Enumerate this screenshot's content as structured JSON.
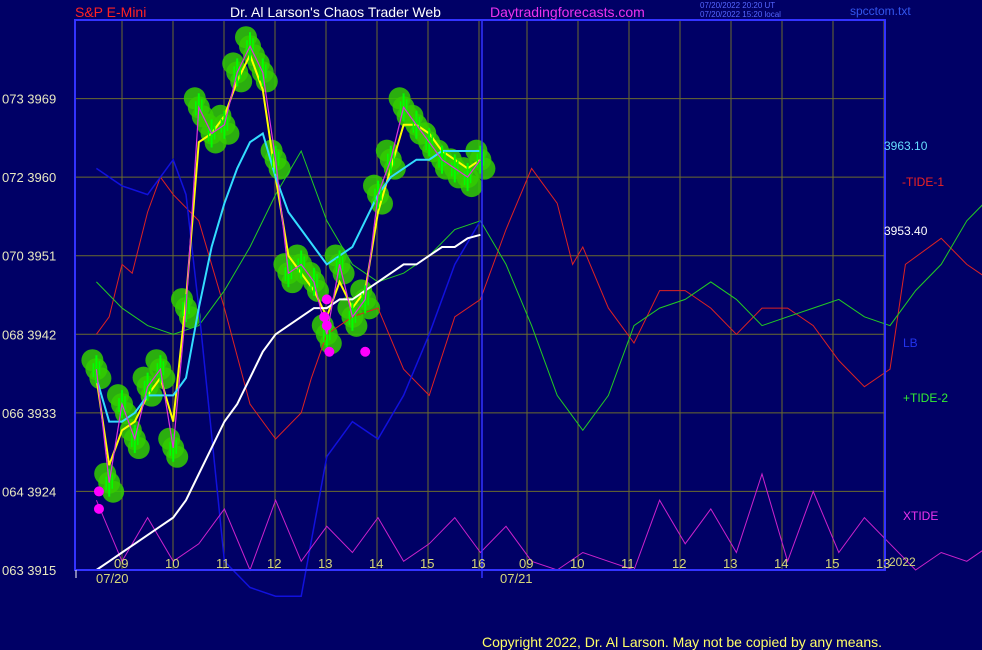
{
  "header": {
    "left_title": "S&P E-Mini",
    "center_title": "Dr. Al Larson's Chaos Trader Web",
    "site": "Daytradingforecasts.com",
    "timestamp_1": "07/20/2022 20:20 UT",
    "timestamp_2": "07/20/2022 15:20 local",
    "file_name": "spcctom.txt"
  },
  "footer": {
    "copyright": "Copyright 2022, Dr. Al Larson. May not be copied by any means."
  },
  "right_labels": {
    "price_1": "3963.10",
    "price_2": "3953.40",
    "tide1": "-TIDE-1",
    "lb": "LB",
    "tide2": "+TIDE-2",
    "xtide": "XTIDE",
    "year": "2022"
  },
  "colors": {
    "background": "#000066",
    "frame": "#3333ff",
    "grid": "#6b6b2e",
    "price_bars": "#00ff00",
    "fast_avg": "#ffff00",
    "medium_avg": "#33ddff",
    "slow_avg": "#ffffff",
    "tide1": "#dd2222",
    "tide2": "#22cc22",
    "lb": "#1111dd",
    "xtide": "#cc22cc",
    "turn_points": "#ff00ff",
    "halo": "#33cc00"
  },
  "chart_data": {
    "type": "line",
    "title": "S&P E-Mini",
    "ylim": [
      3915,
      3978
    ],
    "y_ticks": [
      {
        "code": "063",
        "price": "3915"
      },
      {
        "code": "064",
        "price": "3924"
      },
      {
        "code": "066",
        "price": "3933"
      },
      {
        "code": "068",
        "price": "3942"
      },
      {
        "code": "070",
        "price": "3951"
      },
      {
        "code": "072",
        "price": "3960"
      },
      {
        "code": "073",
        "price": "3969"
      }
    ],
    "x_ticks_hours": [
      "09",
      "10",
      "11",
      "12",
      "13",
      "14",
      "15",
      "16",
      "09",
      "10",
      "11",
      "12",
      "13",
      "14",
      "15",
      "13"
    ],
    "x_date_labels": [
      "07/20",
      "07/21"
    ],
    "x_hours": [
      8.5,
      8.75,
      9.0,
      9.25,
      9.5,
      9.75,
      10.0,
      10.25,
      10.5,
      10.75,
      11.0,
      11.25,
      11.5,
      11.75,
      12.0,
      12.25,
      12.5,
      12.75,
      13.0,
      13.25,
      13.5,
      13.75,
      14.0,
      14.25,
      14.5,
      14.75,
      15.0,
      15.25,
      15.5,
      15.75,
      16.0
    ],
    "series": [
      {
        "name": "price",
        "values": [
          3938,
          3925,
          3934,
          3930,
          3936,
          3938,
          3929,
          3945,
          3968,
          3965,
          3966,
          3972,
          3975,
          3972,
          3962,
          3949,
          3950,
          3948,
          3942,
          3950,
          3944,
          3946,
          3958,
          3962,
          3968,
          3966,
          3964,
          3962,
          3961,
          3960,
          3962
        ]
      },
      {
        "name": "fast_avg",
        "values": [
          3937,
          3927,
          3931,
          3932,
          3935,
          3937,
          3932,
          3946,
          3964,
          3965,
          3967,
          3971,
          3974,
          3970,
          3960,
          3951,
          3949,
          3947,
          3944,
          3948,
          3945,
          3947,
          3956,
          3961,
          3966,
          3966,
          3965,
          3963,
          3962,
          3961,
          3962
        ]
      },
      {
        "name": "medium_avg",
        "values": [
          3937,
          3932,
          3932,
          3933,
          3935,
          3935,
          3935,
          3937,
          3945,
          3952,
          3957,
          3961,
          3964,
          3965,
          3960,
          3956,
          3954,
          3952,
          3950,
          3951,
          3952,
          3955,
          3958,
          3960,
          3961,
          3962,
          3962,
          3963,
          3963,
          3963,
          3963
        ]
      },
      {
        "name": "slow_avg",
        "values": [
          3915,
          3916,
          3917,
          3918,
          3919,
          3920,
          3921,
          3923,
          3926,
          3929,
          3932,
          3934,
          3937,
          3940,
          3942,
          3943,
          3944,
          3945,
          3945,
          3946,
          3946,
          3947,
          3948,
          3949,
          3950,
          3950,
          3951,
          3952,
          3952,
          3953,
          3953.4
        ]
      }
    ],
    "tide1_x": [
      8.5,
      8.75,
      9.0,
      9.2,
      9.5,
      9.75,
      10.0,
      10.5,
      11.0,
      11.5,
      12.0,
      12.5,
      12.7,
      13.0,
      13.5,
      14.0,
      14.5,
      15.0,
      15.5,
      16.0,
      16.5,
      17.0,
      17.5,
      17.8,
      18.0,
      18.5,
      19.0,
      19.5,
      20.0,
      20.5,
      21.0,
      21.5,
      22.0,
      22.5,
      23.0,
      23.5,
      24.0,
      24.3,
      25.0,
      25.5,
      26.0,
      26.5,
      27.0,
      27.5,
      28.0,
      28.5,
      29.0,
      29.5,
      29.9,
      30.5,
      31.0,
      31.5,
      32.0,
      32.5,
      33.0,
      33.5,
      34.0,
      34.5,
      35.0,
      35.3
    ],
    "tide1": [
      3942,
      3944,
      3950,
      3949,
      3956,
      3960,
      3958,
      3955,
      3945,
      3934,
      3930,
      3933,
      3937,
      3942,
      3944,
      3945,
      3938,
      3935,
      3944,
      3946,
      3954,
      3961,
      3957,
      3950,
      3952,
      3945,
      3941,
      3947,
      3947,
      3945,
      3942,
      3945,
      3945,
      3943,
      3939,
      3936,
      3938,
      3950,
      3953,
      3950,
      3948,
      3945,
      3942,
      3942,
      3946,
      3950,
      3953,
      3955,
      3958,
      3960,
      3962,
      3963,
      3960,
      3955,
      3950,
      3945,
      3940,
      3936,
      3934,
      3933
    ],
    "tide2_x": [
      8.5,
      9.0,
      9.5,
      10.0,
      10.5,
      11.0,
      11.5,
      12.0,
      12.5,
      13.0,
      13.5,
      14.0,
      14.5,
      15.0,
      15.5,
      16.0,
      16.5,
      17.0,
      17.5,
      18.0,
      18.5,
      19.0,
      19.5,
      20.0,
      20.5,
      21.0,
      21.5,
      22.0,
      22.5,
      23.0,
      23.5,
      24.0,
      24.5,
      25.0,
      25.5,
      26.0,
      26.5,
      27.0,
      27.5,
      28.0,
      28.5,
      29.0,
      29.5,
      30.0,
      30.5,
      31.0,
      31.5,
      32.0,
      32.5,
      33.0,
      33.5,
      34.0,
      34.5,
      35.0,
      35.3
    ],
    "tide2": [
      3948,
      3945,
      3943,
      3942,
      3943,
      3947,
      3952,
      3958,
      3963,
      3955,
      3950,
      3948,
      3949,
      3951,
      3954,
      3955,
      3950,
      3943,
      3935,
      3931,
      3935,
      3943,
      3945,
      3946,
      3948,
      3946,
      3943,
      3944,
      3945,
      3946,
      3944,
      3943,
      3947,
      3950,
      3955,
      3958,
      3962,
      3962,
      3961,
      3958,
      3955,
      3950,
      3946,
      3945,
      3948,
      3955,
      3958,
      3957,
      3953,
      3950,
      3945,
      3941,
      3937,
      3935,
      3934
    ],
    "lb_x": [
      8.5,
      9.0,
      9.5,
      10.0,
      10.25,
      10.5,
      11.0,
      11.5,
      12.0,
      12.5,
      13.0,
      13.5,
      14.0,
      14.5,
      15.0,
      15.5,
      16.0
    ],
    "lb": [
      3961,
      3959,
      3958,
      3962,
      3958,
      3945,
      3916,
      3913,
      3912,
      3912,
      3928,
      3932,
      3930,
      3935,
      3942,
      3950,
      3955
    ],
    "xtide_x": [
      8.5,
      9.0,
      9.5,
      10.0,
      10.5,
      11.0,
      11.5,
      12.0,
      12.5,
      13.0,
      13.5,
      14.0,
      14.5,
      15.0,
      15.5,
      16.0,
      16.5,
      17.0,
      17.5,
      18.0,
      18.5,
      19.0,
      19.5,
      20.0,
      20.5,
      21.0,
      21.5,
      22.0,
      22.5,
      23.0,
      23.5,
      24.0,
      24.5,
      25.0,
      25.5,
      26.0,
      26.5,
      27.0,
      27.5,
      28.0,
      28.5,
      29.0,
      29.5,
      30.0,
      30.5,
      31.0,
      31.5,
      32.0,
      32.5,
      33.0,
      33.5,
      34.0,
      34.5,
      35.0,
      35.3
    ],
    "xtide": [
      3923,
      3916,
      3921,
      3916,
      3918,
      3922,
      3915,
      3923,
      3916,
      3920,
      3917,
      3921,
      3916,
      3918,
      3921,
      3917,
      3920,
      3916,
      3915,
      3917,
      3916,
      3915,
      3923,
      3918,
      3922,
      3917,
      3926,
      3916,
      3924,
      3917,
      3921,
      3918,
      3915,
      3917,
      3916,
      3918,
      3917,
      3918,
      3919,
      3919,
      3920,
      3920,
      3921,
      3921,
      3921,
      3921,
      3920,
      3920,
      3920,
      3920,
      3920,
      3920,
      3921,
      3921,
      3921
    ],
    "turn_points": [
      {
        "x": 8.55,
        "y": 3922
      },
      {
        "x": 8.55,
        "y": 3924
      },
      {
        "x": 12.95,
        "y": 3944
      },
      {
        "x": 13.0,
        "y": 3946
      },
      {
        "x": 13.0,
        "y": 3943
      },
      {
        "x": 13.05,
        "y": 3940
      },
      {
        "x": 13.75,
        "y": 3940
      }
    ]
  }
}
